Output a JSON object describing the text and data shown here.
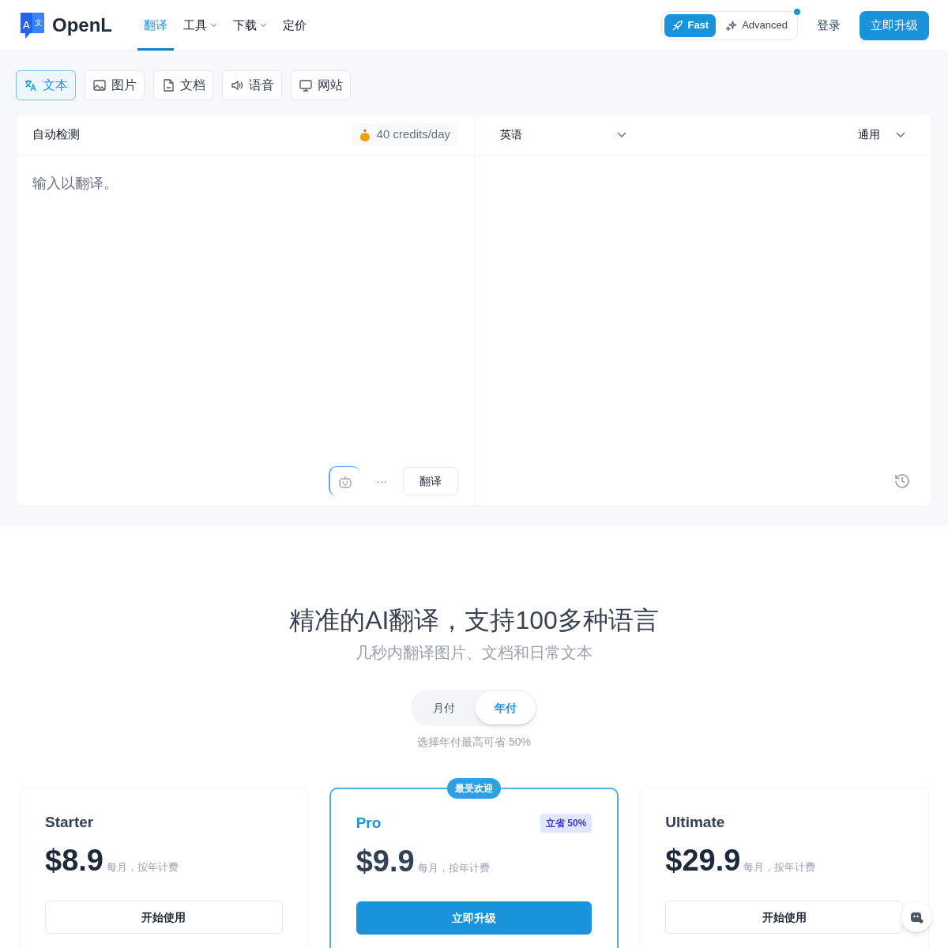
{
  "header": {
    "logo": "OpenL",
    "logo_icon_letters": [
      "A",
      "文"
    ],
    "nav": [
      {
        "label": "翻译",
        "selected": true,
        "dropdown": false
      },
      {
        "label": "工具",
        "selected": false,
        "dropdown": true
      },
      {
        "label": "下载",
        "selected": false,
        "dropdown": true
      },
      {
        "label": "定价",
        "selected": false,
        "dropdown": false
      }
    ],
    "modes": [
      {
        "label": "Fast",
        "kind": "rocket",
        "selected": true
      },
      {
        "label": "Advanced",
        "kind": "sparkle",
        "selected": false
      }
    ],
    "modes_notification": true,
    "login": "登录",
    "upgrade": "立即升级"
  },
  "input_tabs": [
    {
      "label": "文本",
      "kind": "text",
      "selected": true
    },
    {
      "label": "图片",
      "kind": "image",
      "selected": false
    },
    {
      "label": "文档",
      "kind": "document",
      "selected": false
    },
    {
      "label": "语音",
      "kind": "audio",
      "selected": false
    },
    {
      "label": "网站",
      "kind": "website",
      "selected": false
    }
  ],
  "translator": {
    "source_language": "自动检测",
    "credits": "40 credits/day",
    "placeholder": "输入以翻译。",
    "translate_button": "翻译",
    "more": "···",
    "target_language": "英语",
    "style": "通用"
  },
  "pricing": {
    "heading": "精准的AI翻译，支持100多种语言",
    "subheading": "几秒内翻译图片、文档和日常文本",
    "billing": [
      {
        "label": "月付",
        "selected": false
      },
      {
        "label": "年付",
        "selected": true
      }
    ],
    "billing_note": "选择年付最高可省 50%",
    "plans": [
      {
        "name": "Starter",
        "price": "$8.9",
        "period": "每月，按年计费",
        "button": "开始使用",
        "highlighted": false
      },
      {
        "name": "Pro",
        "price": "$9.9",
        "period": "每月，按年计费",
        "button": "立即升级",
        "highlighted": true,
        "badge": "最受欢迎",
        "discount": "立省 50%"
      },
      {
        "name": "Ultimate",
        "price": "$29.9",
        "period": "每月，按年计费",
        "button": "开始使用",
        "highlighted": false
      }
    ]
  }
}
